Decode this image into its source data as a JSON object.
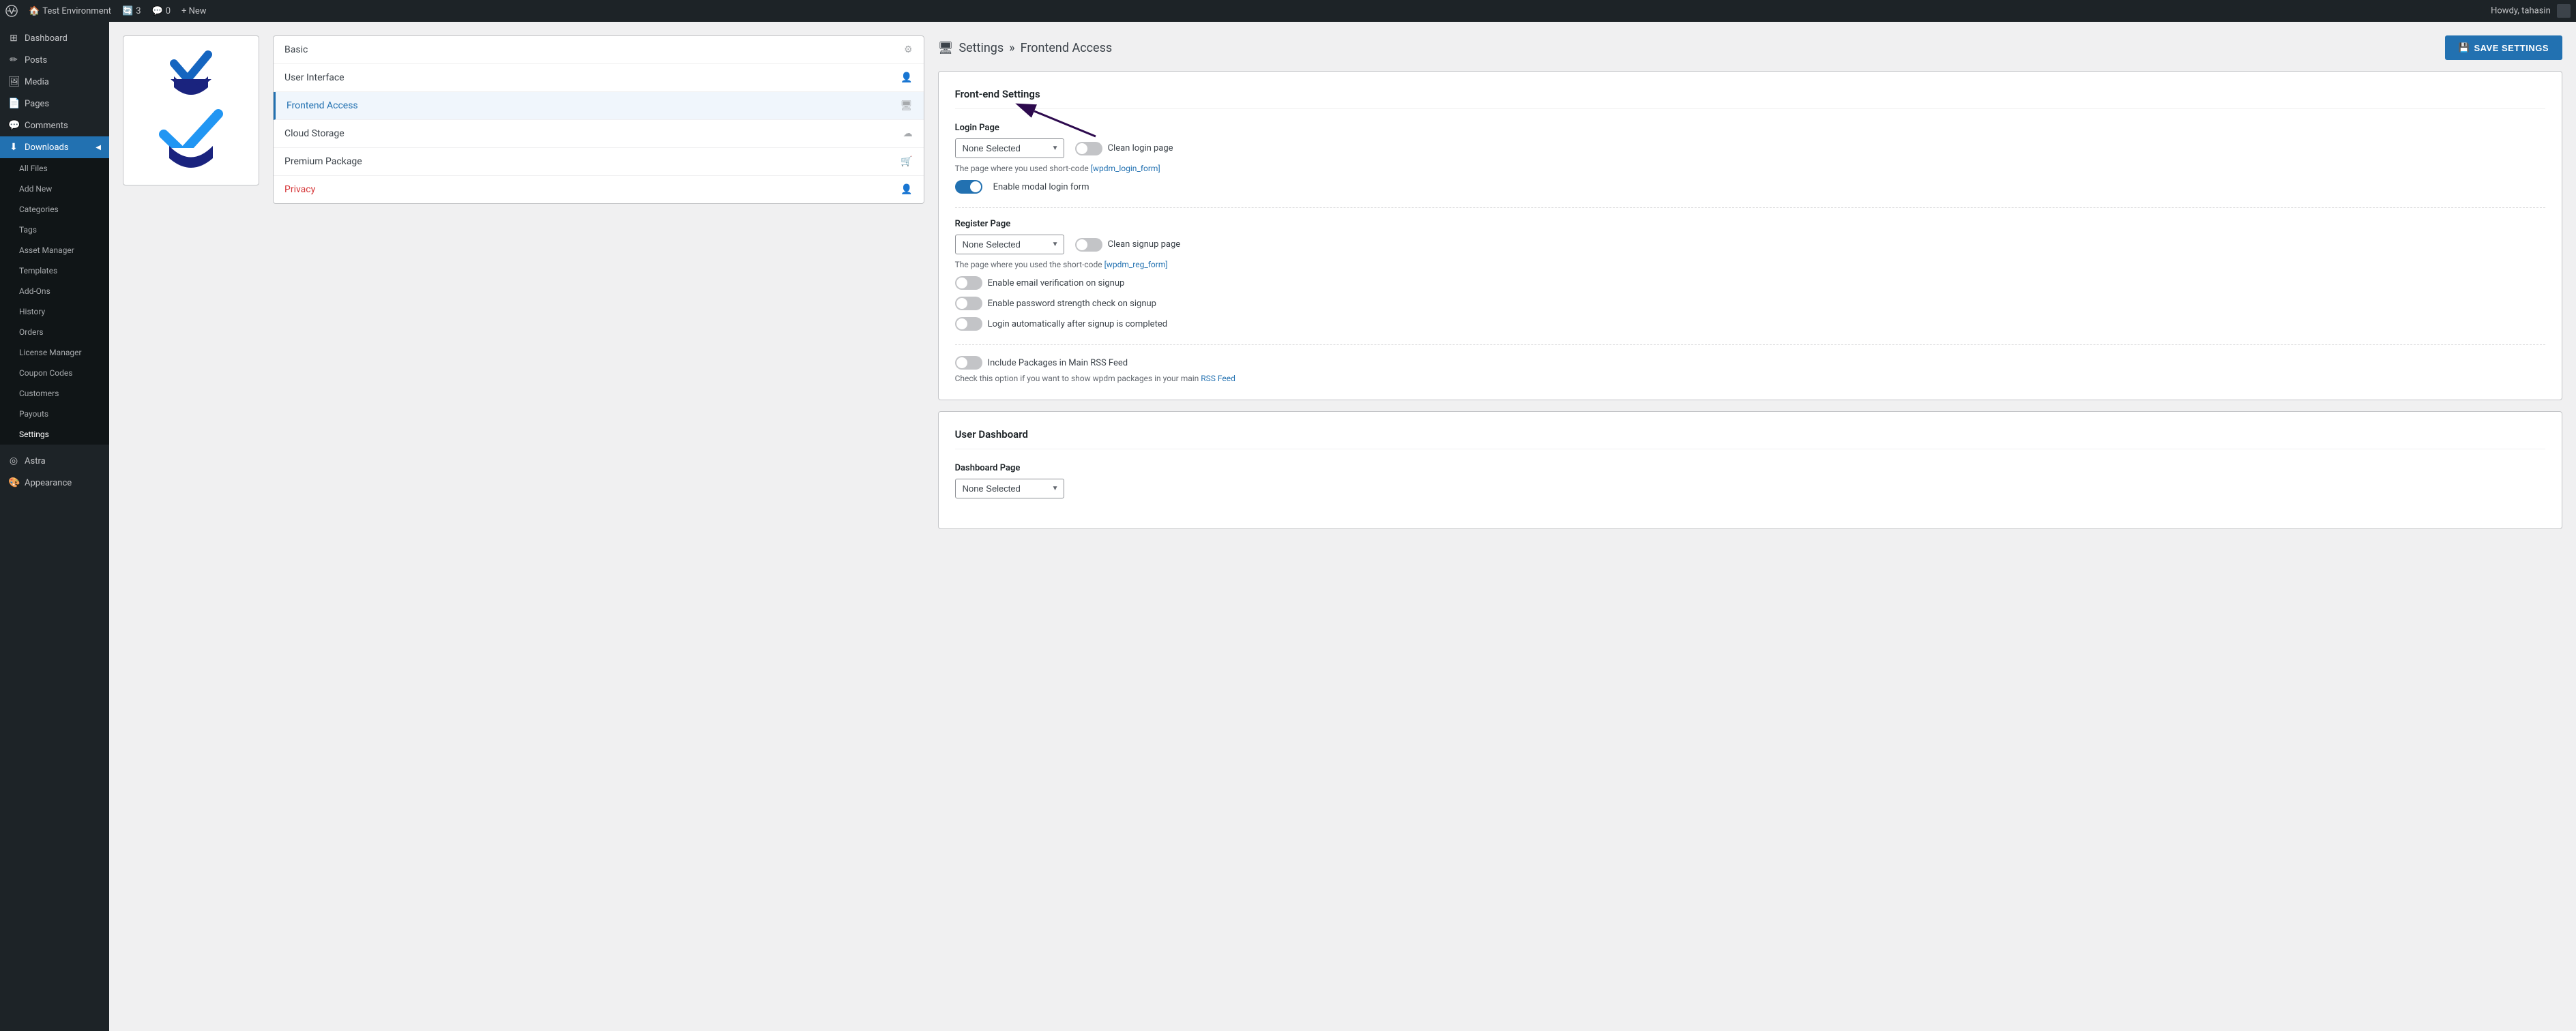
{
  "adminBar": {
    "siteName": "Test Environment",
    "commentCount": "3",
    "commentZero": "0",
    "newLabel": "+ New",
    "userGreeting": "Howdy, tahasin"
  },
  "sidebar": {
    "items": [
      {
        "id": "dashboard",
        "label": "Dashboard",
        "icon": "⊞"
      },
      {
        "id": "posts",
        "label": "Posts",
        "icon": "✏"
      },
      {
        "id": "media",
        "label": "Media",
        "icon": "🖼"
      },
      {
        "id": "pages",
        "label": "Pages",
        "icon": "📄"
      },
      {
        "id": "comments",
        "label": "Comments",
        "icon": "💬"
      },
      {
        "id": "downloads",
        "label": "Downloads",
        "icon": "⬇",
        "active": true
      }
    ],
    "downloadsSubmenu": [
      {
        "id": "all-files",
        "label": "All Files"
      },
      {
        "id": "add-new",
        "label": "Add New"
      },
      {
        "id": "categories",
        "label": "Categories"
      },
      {
        "id": "tags",
        "label": "Tags"
      },
      {
        "id": "asset-manager",
        "label": "Asset Manager"
      },
      {
        "id": "templates",
        "label": "Templates"
      },
      {
        "id": "add-ons",
        "label": "Add-Ons"
      },
      {
        "id": "history",
        "label": "History"
      },
      {
        "id": "orders",
        "label": "Orders"
      },
      {
        "id": "license-manager",
        "label": "License Manager"
      },
      {
        "id": "coupon-codes",
        "label": "Coupon Codes"
      },
      {
        "id": "customers",
        "label": "Customers"
      },
      {
        "id": "payouts",
        "label": "Payouts"
      },
      {
        "id": "settings",
        "label": "Settings",
        "active": true
      }
    ],
    "bottomItems": [
      {
        "id": "astra",
        "label": "Astra",
        "icon": "◎"
      },
      {
        "id": "appearance",
        "label": "Appearance",
        "icon": "🎨"
      }
    ]
  },
  "pluginTabs": {
    "items": [
      {
        "id": "basic",
        "label": "Basic",
        "icon": "⚙"
      },
      {
        "id": "user-interface",
        "label": "User Interface",
        "icon": "👤"
      },
      {
        "id": "frontend-access",
        "label": "Frontend Access",
        "icon": "🖥",
        "active": true
      },
      {
        "id": "cloud-storage",
        "label": "Cloud Storage",
        "icon": "☁"
      },
      {
        "id": "premium-package",
        "label": "Premium Package",
        "icon": "🛒"
      },
      {
        "id": "privacy",
        "label": "Privacy",
        "icon": "👤🔴",
        "privacy": true
      }
    ]
  },
  "breadcrumb": {
    "icon": "🖥",
    "settings": "Settings",
    "separator": "»",
    "current": "Frontend Access"
  },
  "saveButton": {
    "label": "SAVE SETTINGS",
    "icon": "💾"
  },
  "frontendSettings": {
    "sectionTitle": "Front-end Settings",
    "loginPage": {
      "label": "Login Page",
      "selectValue": "None Selected",
      "cleanLoginLabel": "Clean login page",
      "hint": "The page where you used short-code",
      "shortcode": "[wpdm_login_form]",
      "modalToggleLabel": "Enable modal login form",
      "modalEnabled": true
    },
    "registerPage": {
      "label": "Register Page",
      "selectValue": "None Selected",
      "cleanSignupLabel": "Clean signup page",
      "hint": "The page where you used the short-code",
      "shortcode": "[wpdm_reg_form]",
      "toggles": [
        {
          "id": "email-verification",
          "label": "Enable email verification on signup",
          "enabled": false
        },
        {
          "id": "password-strength",
          "label": "Enable password strength check on signup",
          "enabled": false
        },
        {
          "id": "auto-login",
          "label": "Login automatically after signup is completed",
          "enabled": false
        }
      ]
    },
    "rss": {
      "label": "Include Packages in Main RSS Feed",
      "hint": "Check this option if you want to show wpdm packages in your main",
      "linkLabel": "RSS Feed",
      "enabled": false
    }
  },
  "userDashboard": {
    "sectionTitle": "User Dashboard",
    "dashboardPage": {
      "label": "Dashboard Page",
      "selectValue": "None Selected"
    }
  }
}
